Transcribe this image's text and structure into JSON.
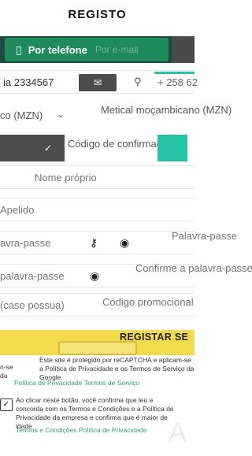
{
  "page": {
    "title": "REGISTO"
  },
  "tabs": {
    "phone_label": "Por telefone",
    "ghost_label": "Por e-mail"
  },
  "fields": {
    "phone_value": "ia 2334567",
    "phone_prefix": "+ 258 62",
    "currency": "Metical moçambicano (MZN)",
    "currency_left": "co (MZN)",
    "confirm_code": "Código de confirmação",
    "first_name": "Nome próprio",
    "last_name": "Apelido",
    "password_left": "avra-passe",
    "password_right": "Palavra-passe",
    "confirm_password_left": "palavra-passe",
    "confirm_password_right": "Confirme a palavra-passe",
    "promo_left": "(caso possua)",
    "promo_right": "Código promocional"
  },
  "actions": {
    "register": "REGISTAR SE"
  },
  "notice": {
    "recaptcha_line1": "Este site é protegido por reCAPTCHA e aplicam-se a Política de Privacidade e os Termos de Serviço da Google.",
    "left_snip1": "n-se",
    "left_snip2": "da",
    "ghost_links": "Política de Privacidade    Termos de Serviço"
  },
  "consent": {
    "text": "Ao clicar neste botão, você confirma que leu e concorda com os Termos e Condições e a Política de Privacidade da empresa e confirma que é maior de idade",
    "ghost": "Termos e Condições    Política de Privacidade"
  }
}
